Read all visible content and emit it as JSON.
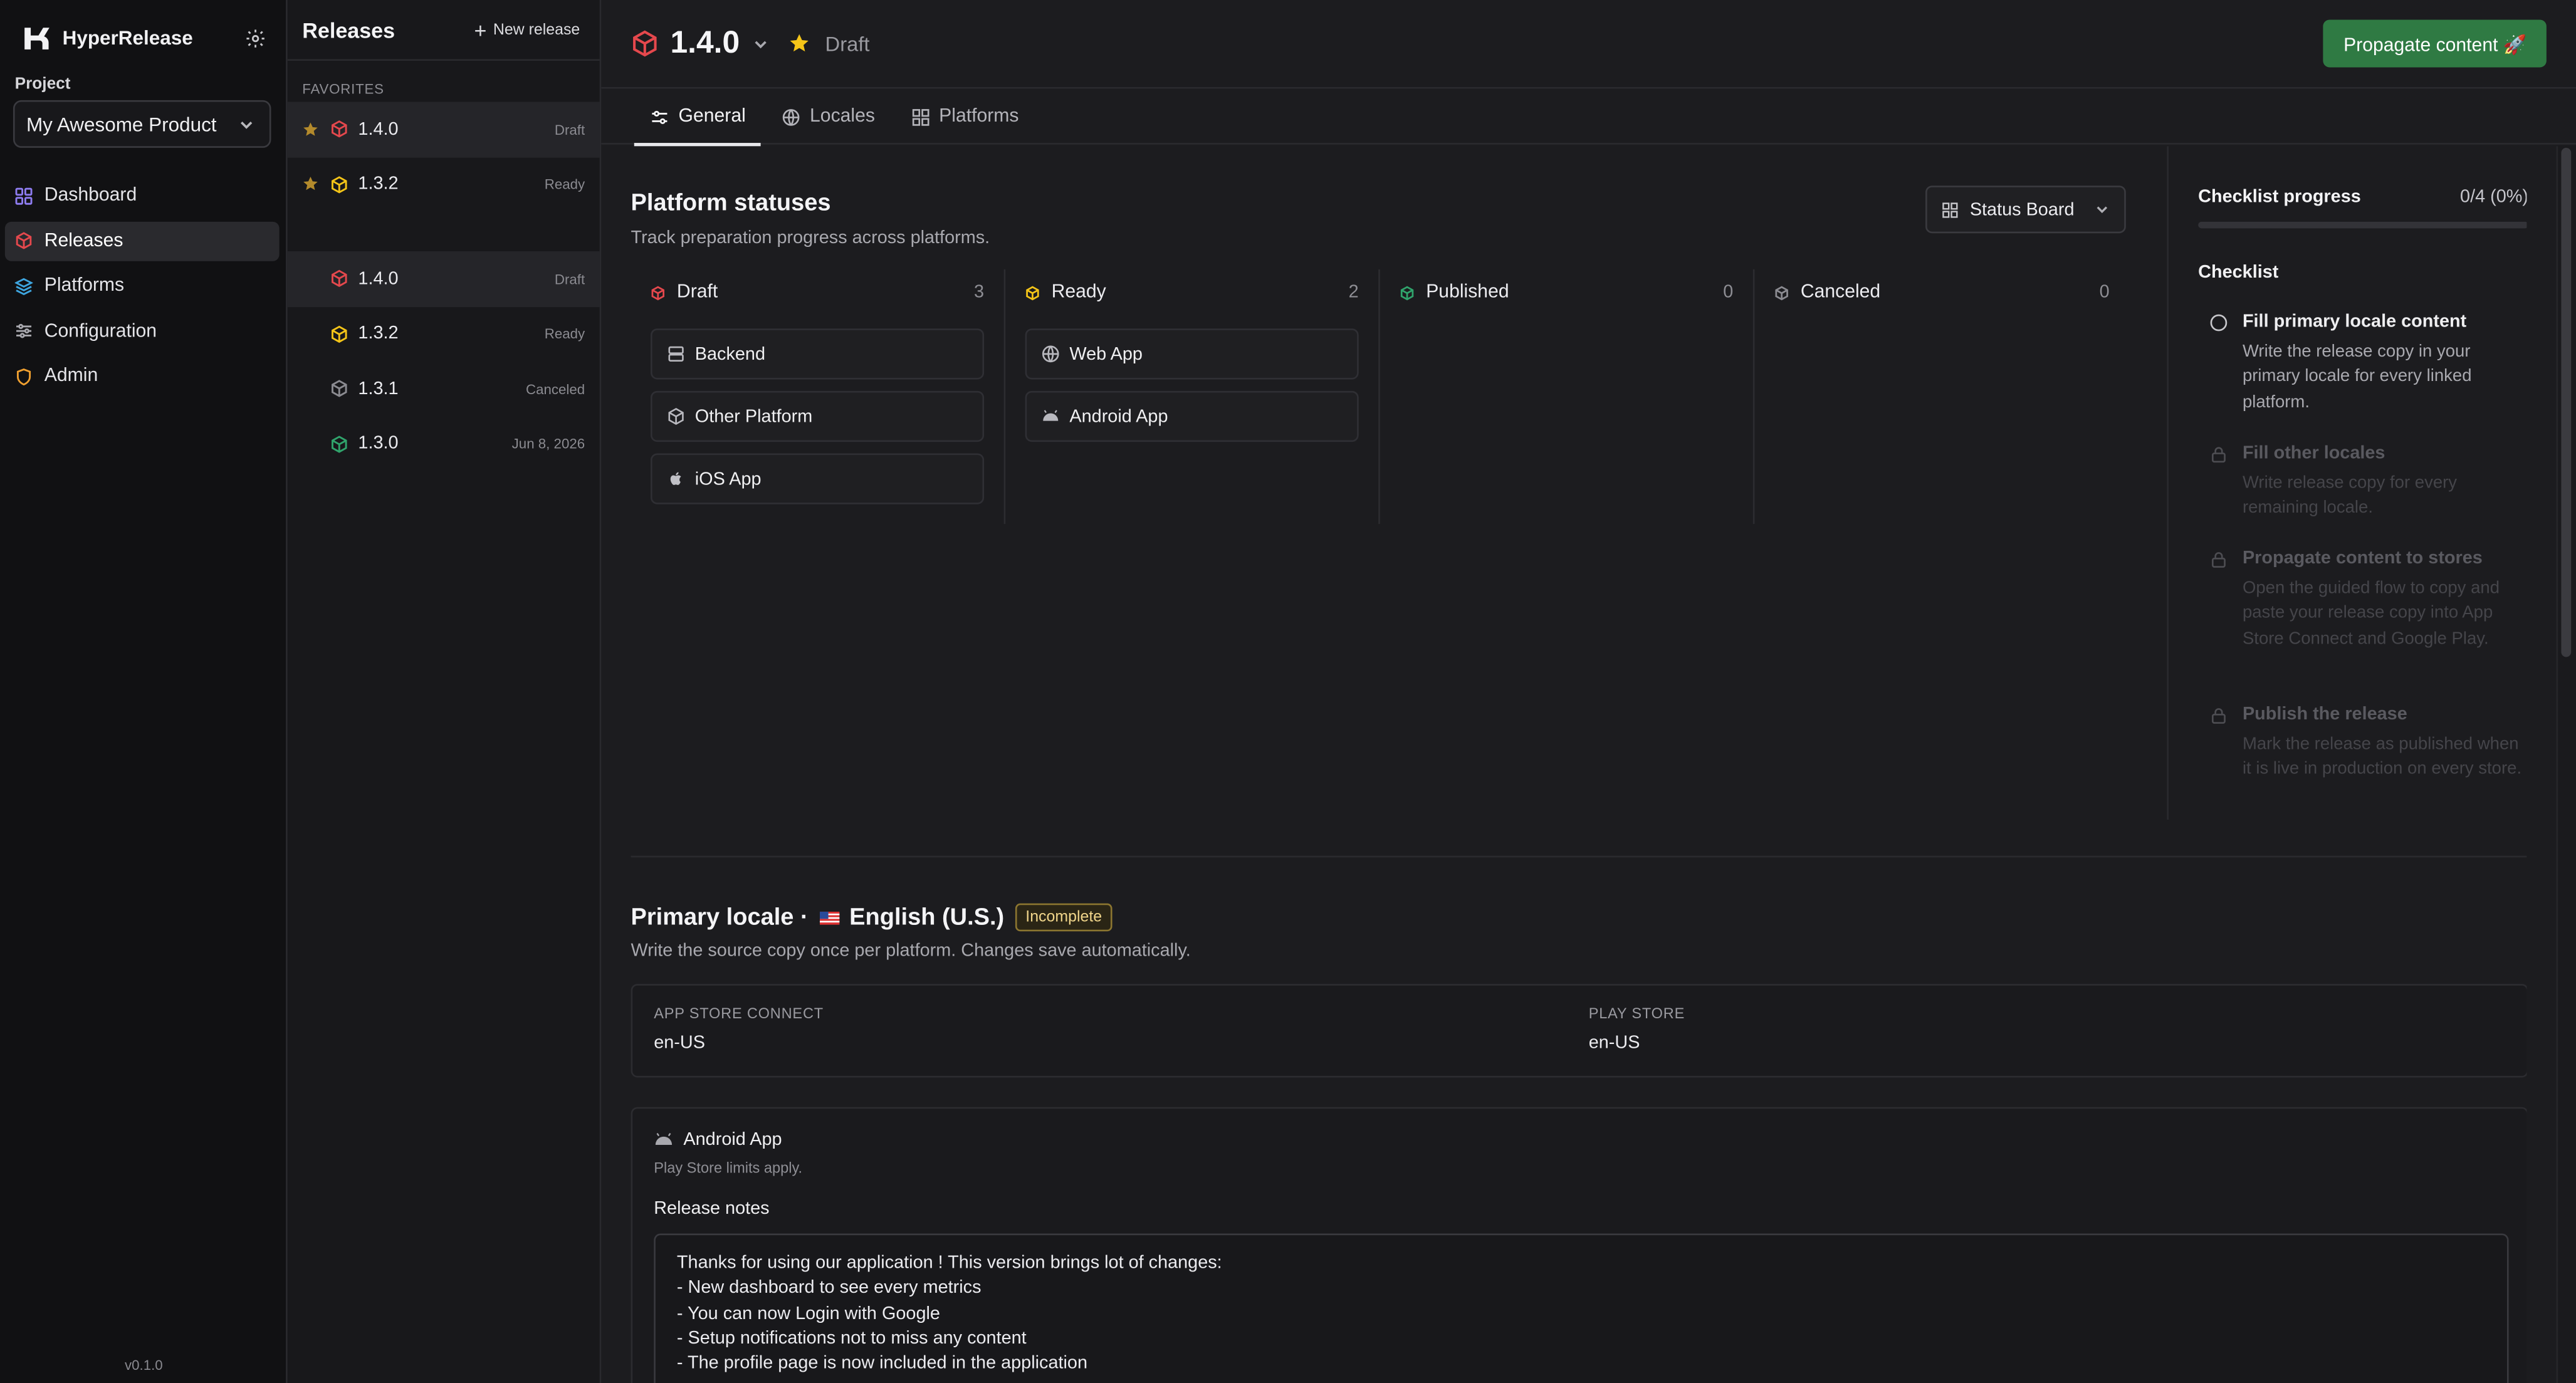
{
  "brand": {
    "name": "HyperRelease"
  },
  "project": {
    "label": "Project",
    "selected": "My Awesome Product"
  },
  "nav": {
    "items": [
      {
        "label": "Dashboard",
        "icon": "grid-icon"
      },
      {
        "label": "Releases",
        "icon": "cube-icon"
      },
      {
        "label": "Platforms",
        "icon": "layers-icon"
      },
      {
        "label": "Configuration",
        "icon": "sliders-icon"
      },
      {
        "label": "Admin",
        "icon": "shield-icon"
      }
    ],
    "version": "v0.1.0"
  },
  "releases": {
    "title": "Releases",
    "new_label": "New release",
    "favorites_label": "FAVORITES",
    "favorites": [
      {
        "version": "1.4.0",
        "status": "Draft"
      },
      {
        "version": "1.3.2",
        "status": "Ready"
      }
    ],
    "all": [
      {
        "version": "1.4.0",
        "status": "Draft"
      },
      {
        "version": "1.3.2",
        "status": "Ready"
      },
      {
        "version": "1.3.1",
        "status": "Canceled"
      },
      {
        "version": "1.3.0",
        "status": "Jun 8, 2026"
      }
    ]
  },
  "header": {
    "version": "1.4.0",
    "status": "Draft",
    "propagate_label": "Propagate content 🚀"
  },
  "tabs": [
    {
      "label": "General",
      "icon": "sliders-icon"
    },
    {
      "label": "Locales",
      "icon": "globe-icon"
    },
    {
      "label": "Platforms",
      "icon": "grid-icon"
    }
  ],
  "platform_statuses": {
    "title": "Platform statuses",
    "subtitle": "Track preparation progress across platforms.",
    "view_label": "Status Board",
    "columns": [
      {
        "name": "Draft",
        "count": "3",
        "color": "#e5484d",
        "cards": [
          {
            "label": "Backend",
            "icon": "server-icon"
          },
          {
            "label": "Other Platform",
            "icon": "cube-icon"
          },
          {
            "label": "iOS App",
            "icon": "apple-icon"
          }
        ]
      },
      {
        "name": "Ready",
        "count": "2",
        "color": "#f5c518",
        "cards": [
          {
            "label": "Web App",
            "icon": "globe-icon"
          },
          {
            "label": "Android App",
            "icon": "android-icon"
          }
        ]
      },
      {
        "name": "Published",
        "count": "0",
        "color": "#30a46c",
        "cards": []
      },
      {
        "name": "Canceled",
        "count": "0",
        "color": "#8b8b91",
        "cards": []
      }
    ]
  },
  "checklist": {
    "progress_label": "Checklist progress",
    "progress_value": "0/4 (0%)",
    "progress_fraction": 0,
    "title": "Checklist",
    "items": [
      {
        "title": "Fill primary locale content",
        "desc": "Write the release copy in your primary locale for every linked platform.",
        "locked": false
      },
      {
        "title": "Fill other locales",
        "desc": "Write release copy for every remaining locale.",
        "locked": true
      },
      {
        "title": "Propagate content to stores",
        "desc": "Open the guided flow to copy and paste your release copy into App Store Connect and Google Play.",
        "locked": true
      },
      {
        "title": "Publish the release",
        "desc": "Mark the release as published when it is live in production on every store.",
        "locked": true
      }
    ]
  },
  "primary_locale": {
    "title_prefix": "Primary locale ·",
    "language": "English (U.S.)",
    "badge": "Incomplete",
    "subtitle": "Write the source copy once per platform. Changes save automatically.",
    "codes": [
      {
        "key": "APP STORE CONNECT",
        "value": "en-US"
      },
      {
        "key": "PLAY STORE",
        "value": "en-US"
      }
    ]
  },
  "android_section": {
    "title": "Android App",
    "subtitle": "Play Store limits apply.",
    "field_label": "Release notes",
    "notes": "Thanks for using our application ! This version brings lot of changes:\n- New dashboard to see every metrics\n- You can now Login with Google\n- Setup notifications not to miss any content\n- The profile page is now included in the application"
  }
}
